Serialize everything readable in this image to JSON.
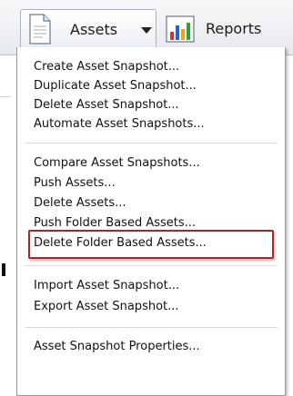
{
  "toolbar": {
    "assets_label": "Assets",
    "reports_label": "Reports"
  },
  "menu": {
    "items": [
      "Create Asset Snapshot...",
      "Duplicate Asset Snapshot...",
      "Delete Asset Snapshot...",
      "Automate Asset Snapshots...",
      "Compare Asset Snapshots...",
      "Push Assets...",
      "Delete Assets...",
      "Push Folder Based Assets...",
      "Delete Folder Based Assets...",
      "Import Asset Snapshot...",
      "Export Asset Snapshot...",
      "Asset Snapshot Properties..."
    ],
    "highlighted_item": "Delete Folder Based Assets..."
  },
  "colors": {
    "highlight_border": "#a3282a",
    "menu_border": "#8f9aa6"
  },
  "icons": [
    "document-icon",
    "caret-down-icon",
    "bar-chart-icon"
  ]
}
